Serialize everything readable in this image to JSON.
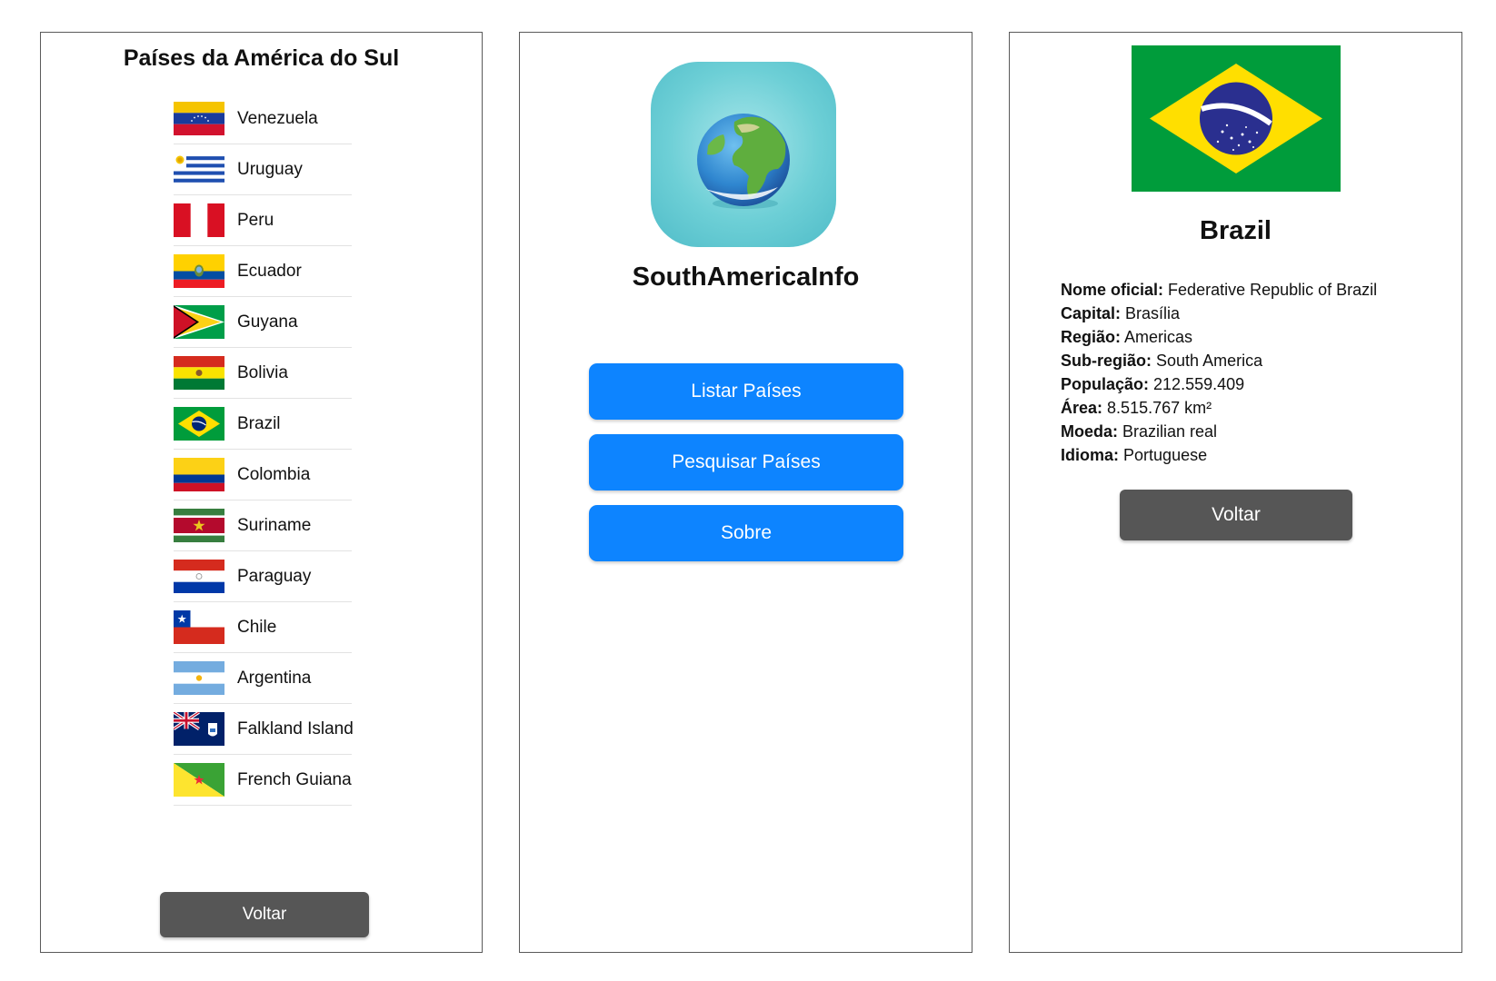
{
  "list_screen": {
    "title": "Países da América do Sul",
    "countries": [
      {
        "name": "Venezuela",
        "flag": "venezuela-flag"
      },
      {
        "name": "Uruguay",
        "flag": "uruguay-flag"
      },
      {
        "name": "Peru",
        "flag": "peru-flag"
      },
      {
        "name": "Ecuador",
        "flag": "ecuador-flag"
      },
      {
        "name": "Guyana",
        "flag": "guyana-flag"
      },
      {
        "name": "Bolivia",
        "flag": "bolivia-flag"
      },
      {
        "name": "Brazil",
        "flag": "brazil-flag"
      },
      {
        "name": "Colombia",
        "flag": "colombia-flag"
      },
      {
        "name": "Suriname",
        "flag": "suriname-flag"
      },
      {
        "name": "Paraguay",
        "flag": "paraguay-flag"
      },
      {
        "name": "Chile",
        "flag": "chile-flag"
      },
      {
        "name": "Argentina",
        "flag": "argentina-flag"
      },
      {
        "name": "Falkland Island",
        "flag": "falkland-islands-flag"
      },
      {
        "name": "French Guiana",
        "flag": "french-guiana-flag"
      }
    ],
    "back_label": "Voltar"
  },
  "home_screen": {
    "icon": "globe-icon",
    "app_name": "SouthAmericaInfo",
    "buttons": {
      "list": "Listar Países",
      "search": "Pesquisar Países",
      "about": "Sobre"
    }
  },
  "detail_screen": {
    "flag": "brazil-flag",
    "country_name": "Brazil",
    "fields": [
      {
        "label": "Nome oficial:",
        "value": "Federative Republic of Brazil"
      },
      {
        "label": "Capital:",
        "value": "Brasília"
      },
      {
        "label": "Região:",
        "value": "Americas"
      },
      {
        "label": "Sub-região:",
        "value": "South America"
      },
      {
        "label": "População:",
        "value": "212.559.409"
      },
      {
        "label": "Área:",
        "value": "8.515.767 km²"
      },
      {
        "label": "Moeda:",
        "value": "Brazilian real"
      },
      {
        "label": "Idioma:",
        "value": "Portuguese"
      }
    ],
    "back_label": "Voltar"
  },
  "colors": {
    "primary_button": "#0d84ff",
    "back_button": "#565656",
    "panel_border": "#5a5a5a",
    "app_icon_bg": "#6dcfd6"
  }
}
